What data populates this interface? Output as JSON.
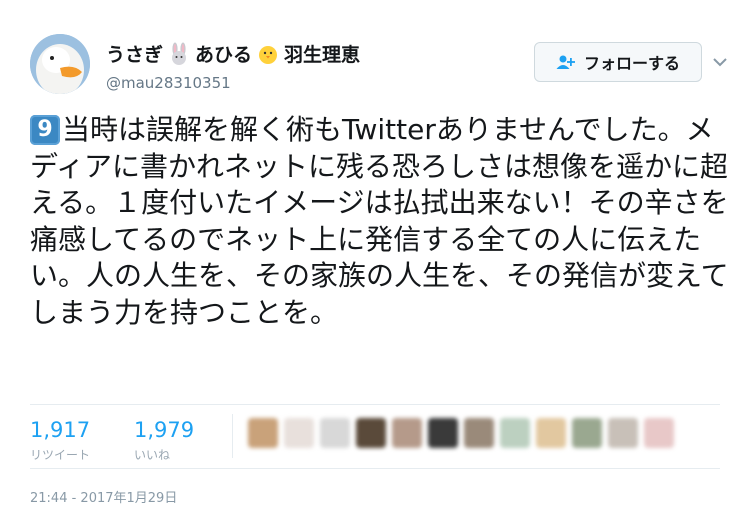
{
  "user": {
    "name_part1": "うさぎ",
    "name_part2": "あひる",
    "name_part3": "羽生理恵",
    "handle": "@mau28310351",
    "avatar_icon": "duck-avatar",
    "emoji1_icon": "rabbit-icon",
    "emoji2_icon": "chick-icon"
  },
  "follow_button": {
    "label": "フォローする",
    "icon": "add-user-icon"
  },
  "tweet": {
    "keycap": "9",
    "text": "当時は誤解を解く術もTwitterありませんでした。メディアに書かれネットに残る恐ろしさは想像を遥かに超える。１度付いたイメージは払拭出来ない！その辛さを痛感してるのでネット上に発信する全ての人に伝えたい。人の人生を、その家族の人生を、その発信が変えてしまう力を持つことを。"
  },
  "stats": {
    "retweets_value": "1,917",
    "retweets_label": "リツイート",
    "likes_value": "1,979",
    "likes_label": "いいね"
  },
  "likers_colors": [
    "#c9a27a",
    "#e8e0dc",
    "#d8d8d8",
    "#5a4a3a",
    "#b59a8a",
    "#3a3a3a",
    "#9a8a7a",
    "#bcd0c0",
    "#e2c8a0",
    "#9aa890",
    "#c8c0b8",
    "#e8c8c8"
  ],
  "timestamp": "21:44 - 2017年1月29日",
  "colors": {
    "link": "#1da1f2",
    "text": "#14171a",
    "muted": "#657786"
  }
}
